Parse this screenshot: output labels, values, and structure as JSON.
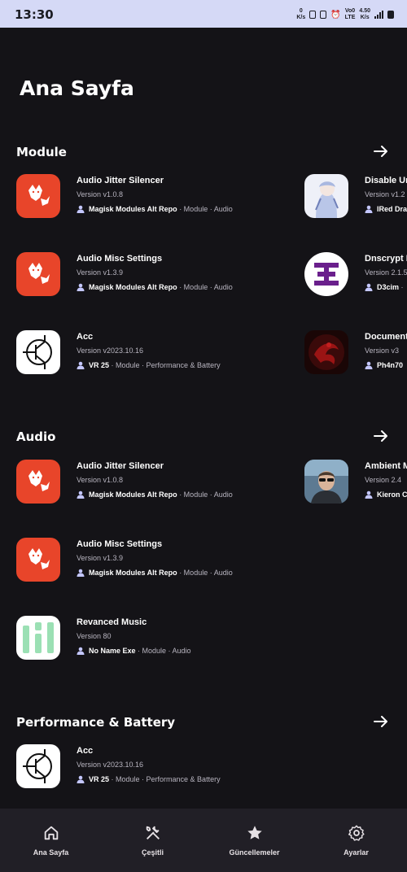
{
  "status_bar": {
    "time": "13:30",
    "speed_top": "0",
    "speed_bottom": "K/s",
    "network_top": "Vo0",
    "network_bottom": "LTE",
    "rate_top": "4.50",
    "rate_bottom": "K/s"
  },
  "page": {
    "title": "Ana Sayfa"
  },
  "sections": [
    {
      "title": "Module",
      "cards": [
        {
          "name": "Audio Jitter Silencer",
          "version": "Version v1.0.8",
          "author": "Magisk Modules Alt Repo",
          "tags": " · Module · Audio",
          "icon": "fox-icon"
        },
        {
          "name": "Disable Un",
          "version": "Version v1.2",
          "author": "IRed Dra",
          "tags": "",
          "icon": "anime-girl-avatar-icon"
        },
        {
          "name": "Audio Misc Settings",
          "version": "Version v1.3.9",
          "author": "Magisk Modules Alt Repo",
          "tags": " · Module · Audio",
          "icon": "fox-icon"
        },
        {
          "name": "Dnscrypt P",
          "version": "Version 2.1.5",
          "author": "D3cim",
          "tags": " ·",
          "icon": "dnscrypt-logo-icon"
        },
        {
          "name": "Acc",
          "version": "Version v2023.10.16",
          "author": "VR 25",
          "tags": " · Module · Performance & Battery",
          "icon": "transistor-icon"
        },
        {
          "name": "Document",
          "version": "Version v3",
          "author": "Ph4n70",
          "tags": "",
          "icon": "red-dragon-icon"
        }
      ]
    },
    {
      "title": "Audio",
      "cards": [
        {
          "name": "Audio Jitter Silencer",
          "version": "Version v1.0.8",
          "author": "Magisk Modules Alt Repo",
          "tags": " · Module · Audio",
          "icon": "fox-icon"
        },
        {
          "name": "Ambient M",
          "version": "Version 2.4",
          "author": "Kieron C",
          "tags": "",
          "icon": "man-sunglasses-avatar-icon"
        },
        {
          "name": "Audio Misc Settings",
          "version": "Version v1.3.9",
          "author": "Magisk Modules Alt Repo",
          "tags": " · Module · Audio",
          "icon": "fox-icon"
        },
        {
          "name": "Revanced Music",
          "version": "Version 80",
          "author": "No Name Exe",
          "tags": " · Module · Audio",
          "icon": "bars-logo-icon"
        }
      ]
    },
    {
      "title": "Performance & Battery",
      "cards": [
        {
          "name": "Acc",
          "version": "Version v2023.10.16",
          "author": "VR 25",
          "tags": " · Module · Performance & Battery",
          "icon": "transistor-icon"
        }
      ]
    }
  ],
  "nav": [
    {
      "label": "Ana Sayfa",
      "icon": "home-icon"
    },
    {
      "label": "Çeşitli",
      "icon": "tools-icon"
    },
    {
      "label": "Güncellemeler",
      "icon": "star-icon"
    },
    {
      "label": "Ayarlar",
      "icon": "gear-icon"
    }
  ],
  "colors": {
    "background": "#141317",
    "status_bar": "#d5d9f6",
    "nav_bar": "#211f26",
    "fox_orange": "#e8452a",
    "dnscrypt_purple": "#6a1f8c",
    "bars_green": "#9be0b4"
  }
}
